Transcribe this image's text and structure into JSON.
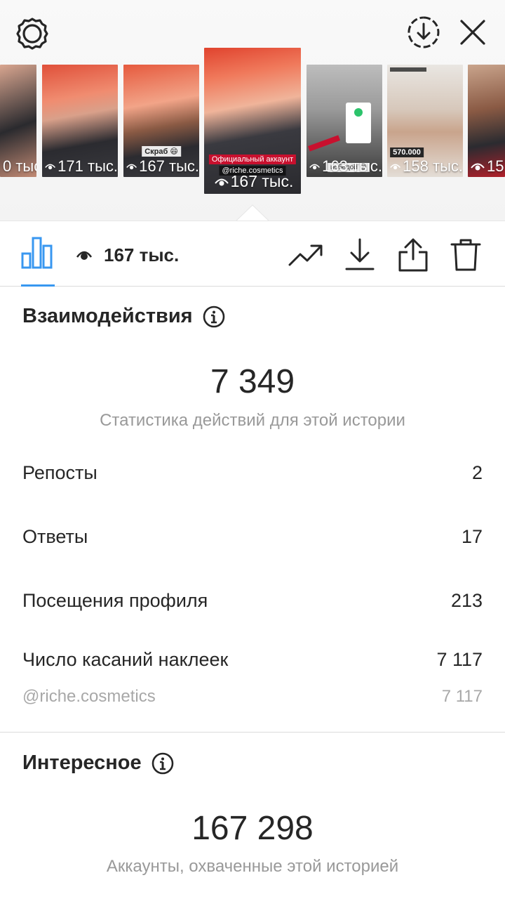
{
  "top_bar": {
    "settings_icon": "gear-icon",
    "download_icon": "download-circle-icon",
    "close_icon": "close-icon"
  },
  "stories": [
    {
      "views": "0 тыс.",
      "caption": ""
    },
    {
      "views": "171 тыс.",
      "caption": ""
    },
    {
      "views": "167 тыс.",
      "caption": "Скраб 😄"
    },
    {
      "views": "167 тыс.",
      "caption": "Официальный аккаунт",
      "mention": "@riche.cosmetics",
      "active": true
    },
    {
      "views": "163 тыс.",
      "caption": "победой 😄"
    },
    {
      "views": "158 тыс.",
      "caption": "570.000"
    },
    {
      "views": "15"
    }
  ],
  "toolbar": {
    "insights_icon": "bar-chart-icon",
    "views_icon": "eye-icon",
    "views_count": "167 тыс.",
    "promote_icon": "trending-up-icon",
    "save_icon": "download-icon",
    "share_icon": "share-icon",
    "delete_icon": "trash-icon"
  },
  "interactions": {
    "title": "Взаимодействия",
    "total": "7 349",
    "caption": "Статистика действий для этой истории",
    "rows": [
      {
        "label": "Репосты",
        "value": "2"
      },
      {
        "label": "Ответы",
        "value": "17"
      },
      {
        "label": "Посещения профиля",
        "value": "213"
      },
      {
        "label": "Число касаний наклеек",
        "value": "7 117"
      }
    ],
    "sub_row": {
      "label": "@riche.cosmetics",
      "value": "7 117"
    }
  },
  "discovery": {
    "title": "Интересное",
    "total": "167 298",
    "caption": "Аккаунты, охваченные этой историей"
  },
  "colors": {
    "accent": "#3897f0",
    "text": "#262626",
    "muted": "#999999",
    "divider": "#dbdbdb"
  }
}
